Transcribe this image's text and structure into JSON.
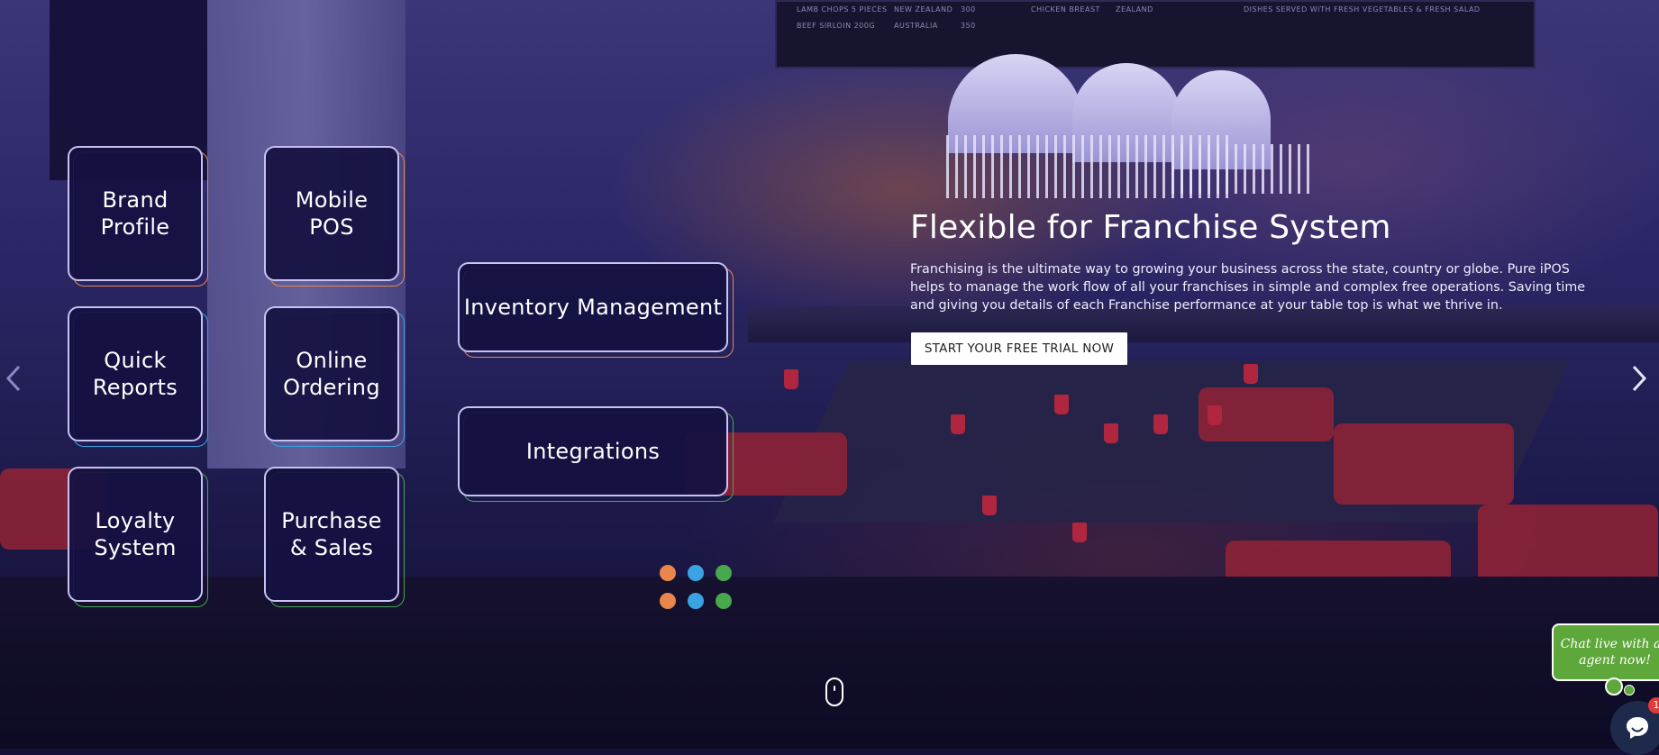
{
  "tiles": [
    {
      "label": "Brand\nProfile",
      "accent": "#e9864b"
    },
    {
      "label": "Mobile\nPOS",
      "accent": "#e9864b"
    },
    {
      "label": "Quick\nReports",
      "accent": "#3aa3e3"
    },
    {
      "label": "Online\nOrdering",
      "accent": "#3aa3e3"
    },
    {
      "label": "Loyalty\nSystem",
      "accent": "#47a84e"
    },
    {
      "label": "Purchase\n& Sales",
      "accent": "#47a84e"
    },
    {
      "label": "Inventory Management",
      "accent": "#e9864b"
    },
    {
      "label": "Integrations",
      "accent": "#47a84e"
    }
  ],
  "dots": [
    "#e9864b",
    "#3aa3e3",
    "#47a84e",
    "#e9864b",
    "#3aa3e3",
    "#47a84e"
  ],
  "hero": {
    "title": "Flexible for Franchise System",
    "body": "Franchising is the ultimate way to growing your business across the state, country or globe. Pure iPOS helps to manage the work flow of all your franchises in simple and complex free operations. Saving time and giving you details of each Franchise performance at your table top is what we thrive in.",
    "cta_label": "START YOUR FREE TRIAL NOW"
  },
  "carousel": {
    "prev_icon": "chevron-left-icon",
    "next_icon": "chevron-right-icon"
  },
  "scroll_indicator_icon": "mouse-scroll-icon",
  "chat": {
    "bubble_text": "Chat live with an agent now!",
    "badge_count": "1",
    "launcher_icon": "chat-icon",
    "accent": "#5ea73b"
  },
  "background": {
    "menu_board": [
      "LAMB CHOPS 5 PIECES",
      "NEW ZEALAND",
      "300",
      "BEEF SIRLOIN 200G",
      "AUSTRALIA",
      "350",
      "CHICKEN BREAST",
      "ZEALAND",
      "DISHES SERVED WITH FRESH VEGETABLES & FRESH SALAD"
    ]
  }
}
